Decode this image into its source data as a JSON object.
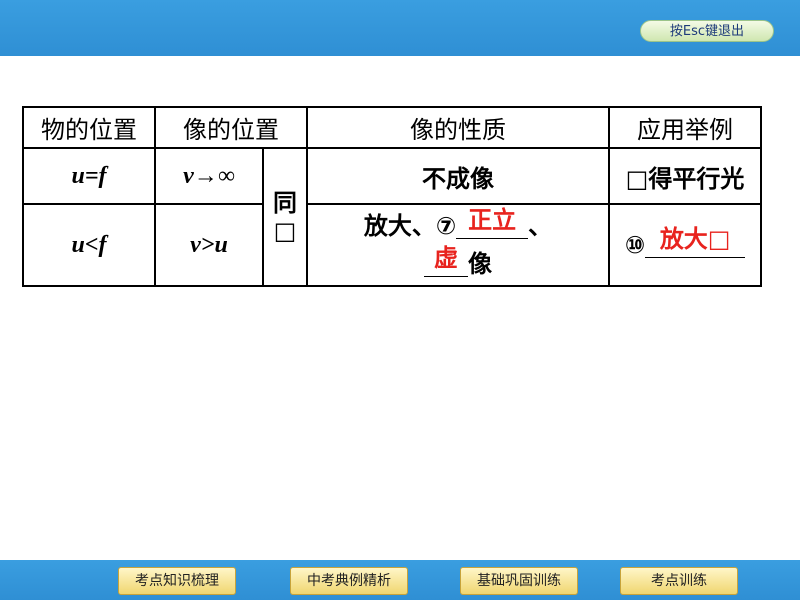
{
  "header": {
    "esc_label": "按Esc键退出"
  },
  "table": {
    "headers": [
      "物的位置",
      "像的位置",
      "像的性质",
      "应用举例"
    ],
    "row1": {
      "object_pos": "u=f",
      "image_pos": "v→∞",
      "same_side": [
        "同",
        "□"
      ],
      "nature": "不成像",
      "example": "□得平行光"
    },
    "row2": {
      "object_pos": "u<f",
      "image_pos": "v>u",
      "nature_prefix": "放大、⑦",
      "answer7": "正立",
      "nature_sep": "、",
      "answer8": "虚",
      "nature_suffix": "像",
      "example_prefix": "⑩",
      "answer10": "放大□"
    }
  },
  "footer": {
    "nav": [
      "考点知识梳理",
      "中考典例精析",
      "基础巩固训练",
      "考点训练"
    ]
  }
}
